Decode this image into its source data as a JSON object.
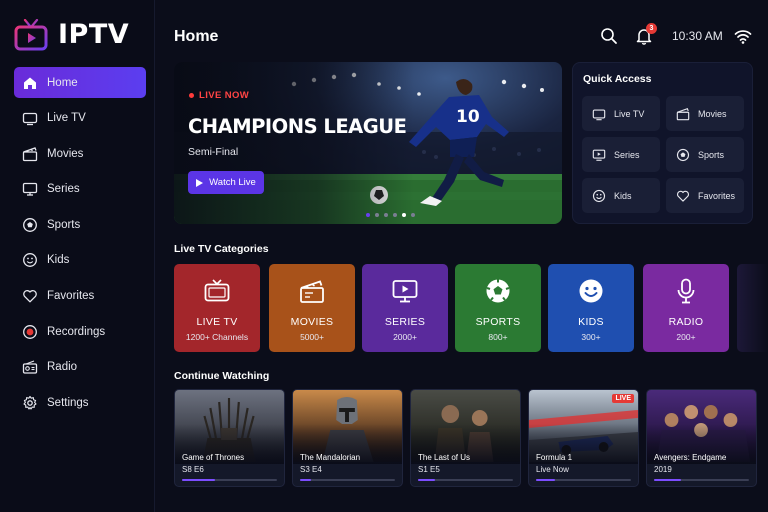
{
  "app": {
    "name": "IPTV"
  },
  "sidebar": {
    "items": [
      {
        "label": "Home",
        "icon": "home-icon",
        "active": true
      },
      {
        "label": "Live TV",
        "icon": "tv-icon"
      },
      {
        "label": "Movies",
        "icon": "clapperboard-icon"
      },
      {
        "label": "Series",
        "icon": "monitor-icon"
      },
      {
        "label": "Sports",
        "icon": "soccer-ball-icon"
      },
      {
        "label": "Kids",
        "icon": "smiley-icon"
      },
      {
        "label": "Favorites",
        "icon": "heart-icon"
      },
      {
        "label": "Recordings",
        "icon": "record-icon"
      },
      {
        "label": "Radio",
        "icon": "radio-icon"
      },
      {
        "label": "Settings",
        "icon": "gear-icon"
      }
    ]
  },
  "header": {
    "title": "Home",
    "notifications_count": "3",
    "time": "10:30 AM"
  },
  "hero": {
    "live_label": "LIVE NOW",
    "title": "CHAMPIONS LEAGUE",
    "subtitle": "Semi-Final",
    "button_label": "Watch Live",
    "player_number": "10",
    "slide_count": 6,
    "active_slide": 5
  },
  "quick_access": {
    "title": "Quick Access",
    "items": [
      {
        "label": "Live TV",
        "icon": "tv-icon"
      },
      {
        "label": "Movies",
        "icon": "clapperboard-icon"
      },
      {
        "label": "Series",
        "icon": "monitor-icon"
      },
      {
        "label": "Sports",
        "icon": "soccer-ball-icon"
      },
      {
        "label": "Kids",
        "icon": "smiley-icon"
      },
      {
        "label": "Favorites",
        "icon": "heart-icon"
      }
    ]
  },
  "categories": {
    "title": "Live TV Categories",
    "items": [
      {
        "name": "LIVE TV",
        "count": "1200+ Channels",
        "color": "#a3262b",
        "icon": "tv-icon"
      },
      {
        "name": "MOVIES",
        "count": "5000+",
        "color": "#a8521a",
        "icon": "clapperboard-icon"
      },
      {
        "name": "SERIES",
        "count": "2000+",
        "color": "#5a2a9c",
        "icon": "monitor-icon"
      },
      {
        "name": "SPORTS",
        "count": "800+",
        "color": "#2b7a33",
        "icon": "soccer-ball-icon"
      },
      {
        "name": "KIDS",
        "count": "300+",
        "color": "#1f4fb0",
        "icon": "smiley-icon"
      },
      {
        "name": "RADIO",
        "count": "200+",
        "color": "#7a2aa0",
        "icon": "microphone-icon"
      }
    ]
  },
  "continue_watching": {
    "title": "Continue Watching",
    "items": [
      {
        "title": "Game of Thrones",
        "sub": "S8 E6",
        "progress": 0.35,
        "live": false
      },
      {
        "title": "The Mandalorian",
        "sub": "S3 E4",
        "progress": 0.12,
        "live": false
      },
      {
        "title": "The Last of Us",
        "sub": "S1 E5",
        "progress": 0.18,
        "live": false
      },
      {
        "title": "Formula 1",
        "sub": "Live Now",
        "progress": 0.2,
        "live": true,
        "live_label": "LIVE"
      },
      {
        "title": "Avengers: Endgame",
        "sub": "2019",
        "progress": 0.28,
        "live": false
      }
    ]
  },
  "colors": {
    "accent": "#5b35e6",
    "live": "#e53935",
    "background": "#0b0d1a"
  }
}
